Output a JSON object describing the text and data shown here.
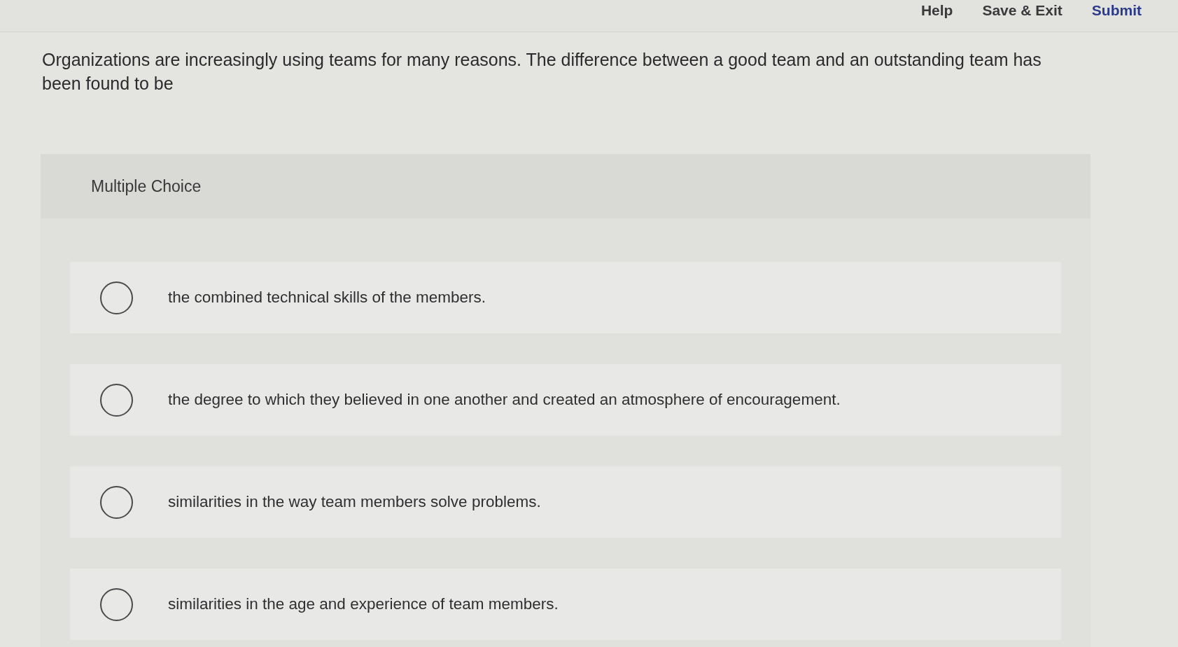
{
  "header": {
    "links": [
      {
        "label": "Help",
        "kind": "plain"
      },
      {
        "label": "Save & Exit",
        "kind": "plain"
      },
      {
        "label": "Submit",
        "kind": "primary"
      }
    ]
  },
  "question": {
    "text": "Organizations are increasingly using teams for many reasons. The difference between a good team and an outstanding team has been found to be"
  },
  "multiple_choice": {
    "heading": "Multiple Choice",
    "options": [
      {
        "label": "the combined technical skills of the members.",
        "selected": false
      },
      {
        "label": "the degree to which they believed in one another and created an atmosphere of encouragement.",
        "selected": false
      },
      {
        "label": "similarities in the way team members solve problems.",
        "selected": false
      },
      {
        "label": "similarities in the age and experience of team members.",
        "selected": false
      }
    ]
  }
}
